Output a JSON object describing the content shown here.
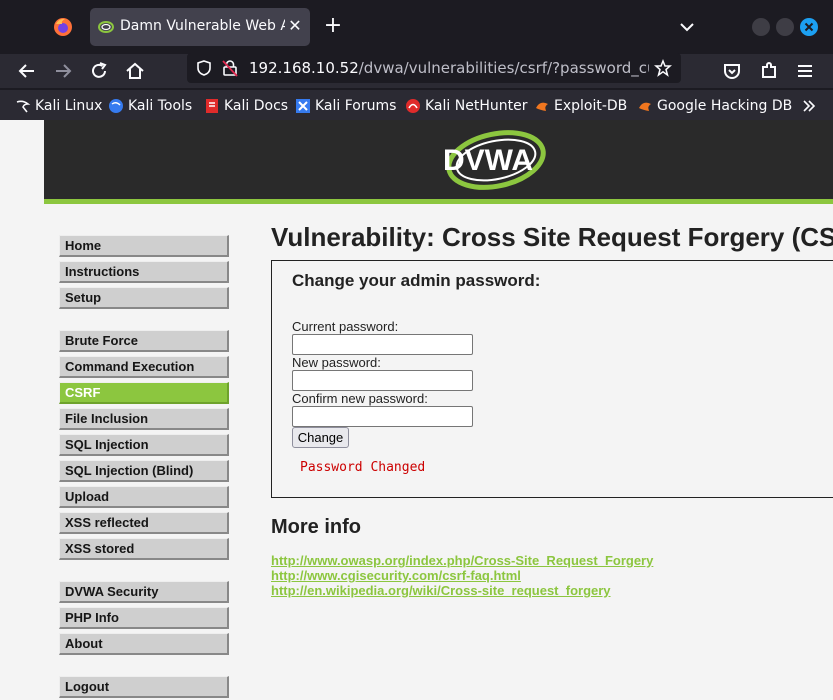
{
  "browser": {
    "tab_title": "Damn Vulnerable Web Application (DVWA)",
    "url_host": "192.168.10.52",
    "url_path": "/dvwa/vulnerabilities/csrf/?password_current=",
    "bookmarks": [
      {
        "label": "Kali Linux",
        "icon": "kali-dragon-icon"
      },
      {
        "label": "Kali Tools",
        "icon": "kali-tools-icon"
      },
      {
        "label": "Kali Docs",
        "icon": "kali-docs-icon"
      },
      {
        "label": "Kali Forums",
        "icon": "kali-forums-icon"
      },
      {
        "label": "Kali NetHunter",
        "icon": "nethunter-icon"
      },
      {
        "label": "Exploit-DB",
        "icon": "exploit-db-icon"
      },
      {
        "label": "Google Hacking DB",
        "icon": "ghdb-icon"
      }
    ],
    "colors": {
      "accent": "#1ca0f2",
      "tab_bg": "#42414d",
      "toolbar_bg": "#2b2a33"
    }
  },
  "dvwa": {
    "logo_text": "DVWA",
    "colors": {
      "accent": "#8cc63f",
      "header_bg": "#2a2a2a"
    },
    "menu": {
      "group1": [
        "Home",
        "Instructions",
        "Setup"
      ],
      "group2": [
        "Brute Force",
        "Command Execution",
        "CSRF",
        "File Inclusion",
        "SQL Injection",
        "SQL Injection (Blind)",
        "Upload",
        "XSS reflected",
        "XSS stored"
      ],
      "group3": [
        "DVWA Security",
        "PHP Info",
        "About"
      ],
      "group4": [
        "Logout"
      ],
      "active": "CSRF"
    },
    "page_title": "Vulnerability: Cross Site Request Forgery (CSRF)",
    "form": {
      "heading": "Change your admin password:",
      "current_label": "Current password:",
      "new_label": "New password:",
      "confirm_label": "Confirm new password:",
      "button_label": "Change",
      "message": "Password Changed"
    },
    "more_info": {
      "title": "More info",
      "links": [
        "http://www.owasp.org/index.php/Cross-Site_Request_Forgery",
        "http://www.cgisecurity.com/csrf-faq.html",
        "http://en.wikipedia.org/wiki/Cross-site_request_forgery"
      ]
    }
  }
}
